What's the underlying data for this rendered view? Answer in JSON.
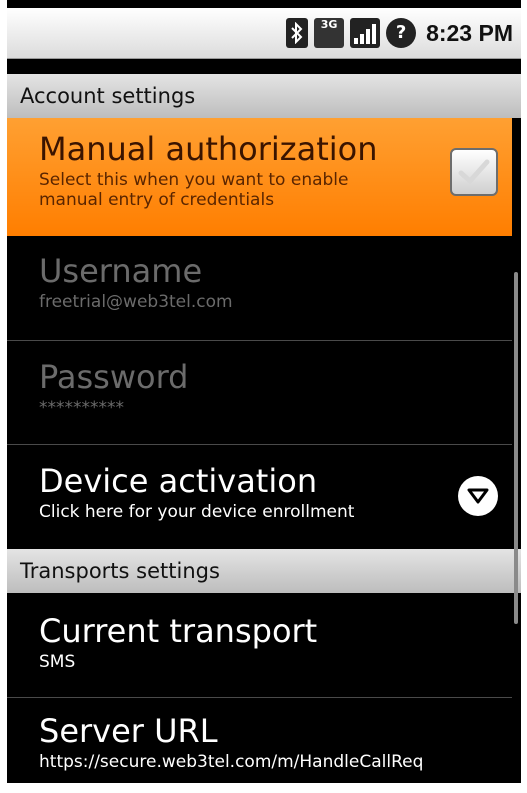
{
  "status_bar": {
    "network_label": "3G",
    "time": "8:23 PM"
  },
  "account_header": "Account settings",
  "manual_auth": {
    "title": "Manual authorization",
    "subtitle_line1": "Select this when you want to enable",
    "subtitle_line2": "manual entry of credentials",
    "checked": true
  },
  "username": {
    "title": "Username",
    "value": "freetrial@web3tel.com"
  },
  "password": {
    "title": "Password",
    "value": "**********"
  },
  "device_activation": {
    "title": "Device activation",
    "subtitle": "Click here for your device enrollment"
  },
  "transports_header": "Transports settings",
  "current_transport": {
    "title": "Current transport",
    "value": "SMS"
  },
  "server_url": {
    "title": "Server URL",
    "value": "https://secure.web3tel.com/m/HandleCallReq"
  },
  "colors": {
    "highlight": "#ff8c1a",
    "background": "#000000",
    "disabled_text": "#6b6b6b"
  }
}
